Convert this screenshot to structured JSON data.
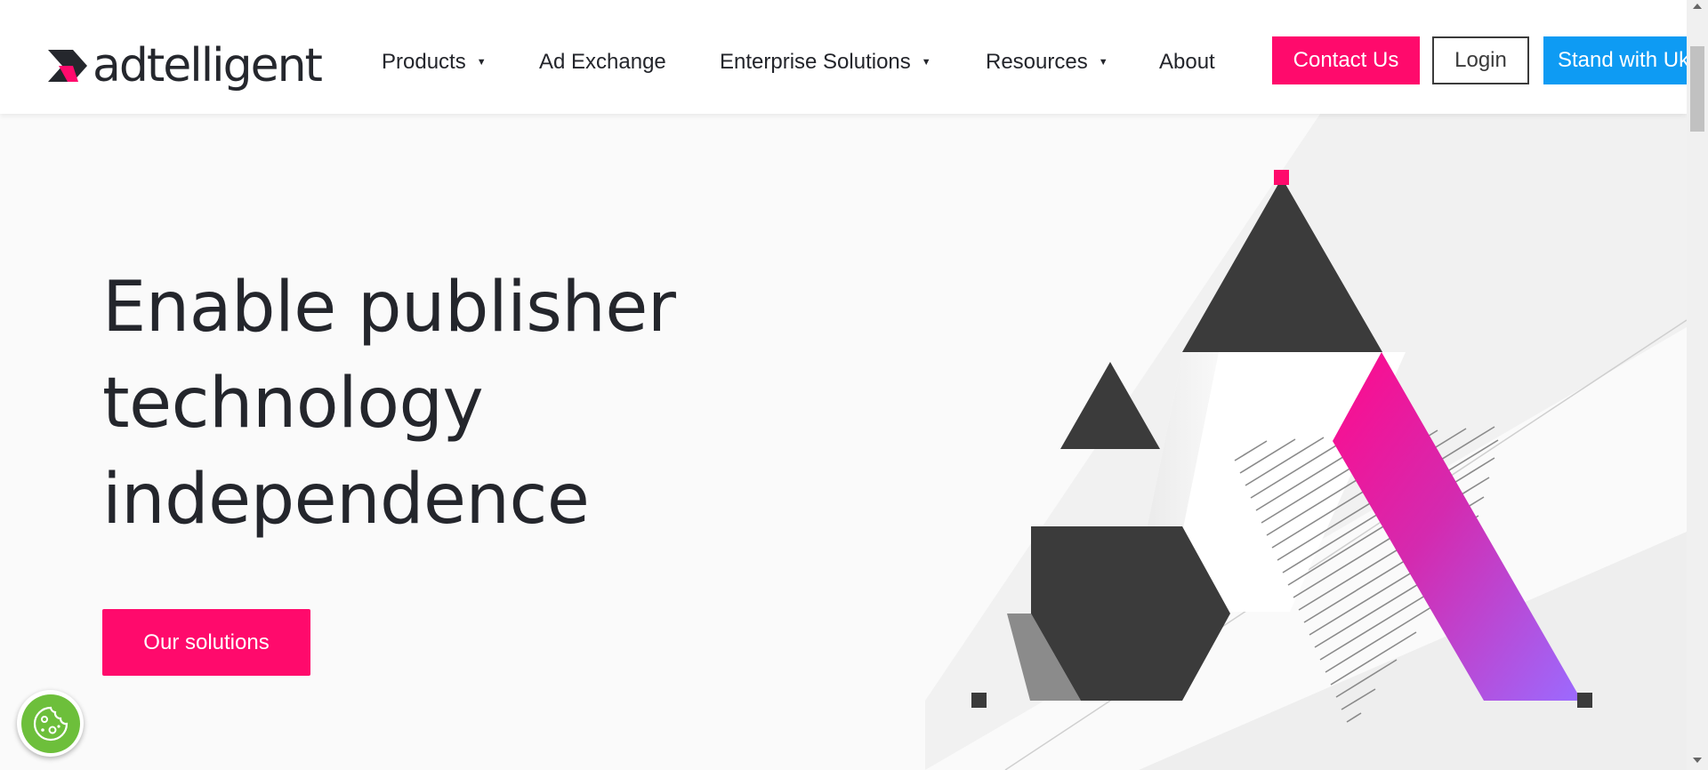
{
  "header": {
    "logo_text": "adtelligent",
    "nav": [
      {
        "label": "Products",
        "has_dropdown": true
      },
      {
        "label": "Ad Exchange",
        "has_dropdown": false
      },
      {
        "label": "Enterprise Solutions",
        "has_dropdown": true
      },
      {
        "label": "Resources",
        "has_dropdown": true
      },
      {
        "label": "About",
        "has_dropdown": false
      }
    ],
    "caret": "▼",
    "buttons": {
      "contact": "Contact Us",
      "login": "Login",
      "ukraine": "Stand with Ukraine"
    }
  },
  "hero": {
    "title_lines": [
      "Enable publisher",
      "technology",
      "independence"
    ],
    "cta": "Our solutions"
  },
  "cookie": {
    "icon": "cookie-icon"
  },
  "colors": {
    "accent": "#ff0a6c",
    "dark": "#3b3b3b",
    "blue": "#0e9bf3",
    "gradient_end": "#9b6bff",
    "cookie_green": "#6dbf3b"
  }
}
